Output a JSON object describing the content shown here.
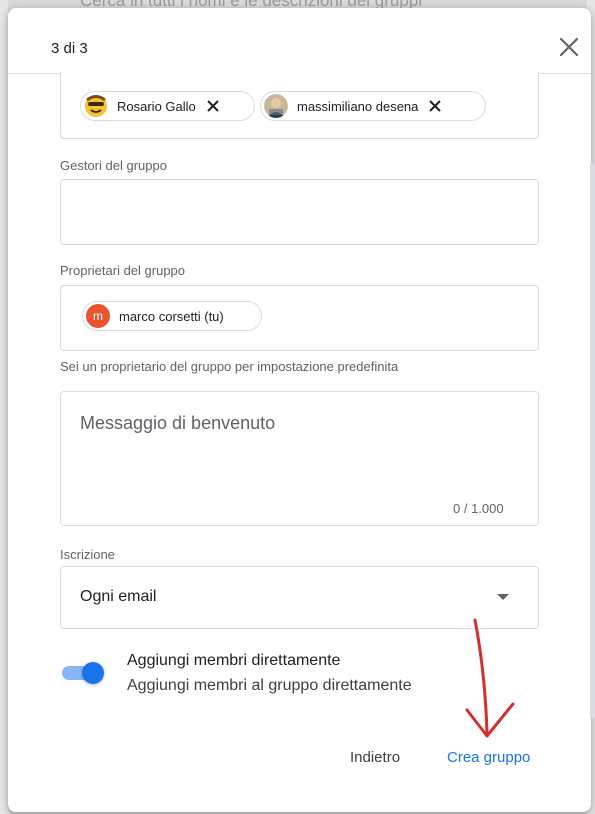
{
  "background": {
    "search_hint": "Cerca in tutti i nomi e le descrizioni dei gruppi"
  },
  "dialog": {
    "step": "3 di 3",
    "close_icon": "close-icon"
  },
  "members": {
    "chips": [
      {
        "name": "Rosario Gallo",
        "avatar_icon": "avatar-emoji-icon"
      },
      {
        "name": "massimiliano desena",
        "avatar_icon": "avatar-photo-icon"
      }
    ]
  },
  "managers": {
    "label": "Gestori del gruppo"
  },
  "owners": {
    "label": "Proprietari del gruppo",
    "chip": {
      "initial": "m",
      "name": "marco corsetti (tu)"
    },
    "helper": "Sei un proprietario del gruppo per impostazione predefinita"
  },
  "welcome": {
    "placeholder": "Messaggio di benvenuto",
    "counter": "0 / 1.000"
  },
  "subscription": {
    "label": "Iscrizione",
    "value": "Ogni email"
  },
  "direct_add": {
    "title": "Aggiungi membri direttamente",
    "subtitle": "Aggiungi membri al gruppo direttamente",
    "enabled": true
  },
  "actions": {
    "back": "Indietro",
    "create": "Crea gruppo"
  },
  "colors": {
    "accent": "#1a73e8",
    "annotation_arrow": "#d32f2f",
    "owner_avatar": "#e8542b"
  }
}
